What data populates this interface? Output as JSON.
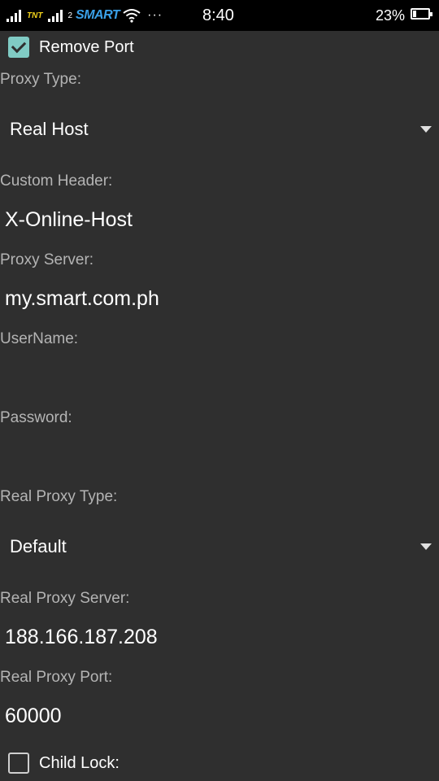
{
  "status_bar": {
    "carrier1": "TNT",
    "sim2_label": "2",
    "carrier2": "SMART",
    "overflow": "···",
    "time": "8:40",
    "battery_pct": "23%",
    "battery_level": 0.23,
    "icons": [
      "signal-icon",
      "signal-icon",
      "wifi-icon",
      "battery-icon"
    ]
  },
  "form": {
    "remove_port": {
      "label": "Remove Port",
      "checked": true
    },
    "proxy_type": {
      "label": "Proxy Type:",
      "value": "Real Host"
    },
    "custom_header": {
      "label": "Custom Header:",
      "value": "X-Online-Host"
    },
    "proxy_server": {
      "label": "Proxy Server:",
      "value": "my.smart.com.ph"
    },
    "username": {
      "label": "UserName:",
      "value": ""
    },
    "password": {
      "label": "Password:",
      "value": ""
    },
    "real_proxy_type": {
      "label": "Real Proxy Type:",
      "value": "Default"
    },
    "real_proxy_server": {
      "label": "Real Proxy Server:",
      "value": "188.166.187.208"
    },
    "real_proxy_port": {
      "label": "Real Proxy Port:",
      "value": "60000"
    },
    "child_lock": {
      "label": "Child Lock:",
      "checked": false
    }
  },
  "colors": {
    "background": "#2f2f2f",
    "accent": "#80cbc4",
    "label": "#b4b4b4"
  }
}
